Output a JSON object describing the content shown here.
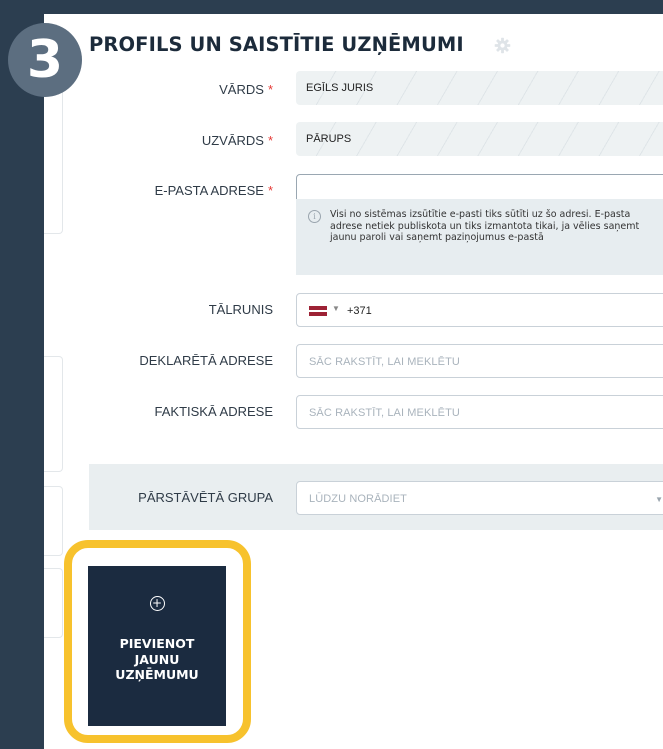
{
  "step_number": "3",
  "section": {
    "title": "PROFILS UN SAISTĪTIE UZŅĒMUMI",
    "settings_icon": "gear-icon"
  },
  "form": {
    "first_name": {
      "label": "VĀRDS",
      "required_mark": "*",
      "value": "EGĪLS JURIS"
    },
    "last_name": {
      "label": "UZVĀRDS",
      "required_mark": "*",
      "value": "PĀRUPS"
    },
    "email": {
      "label": "E-PASTA ADRESE",
      "required_mark": "*",
      "value": "",
      "hint": "Visi no sistēmas izsūtītie e-pasti tiks sūtīti uz šo adresi. E-pasta adrese netiek publiskota un tiks izmantota tikai, ja vēlies saņemt jaunu paroli vai saņemt paziņojumus e-pastā"
    },
    "phone": {
      "label": "TĀLRUNIS",
      "country_flag": "latvia-flag",
      "dial_code": "+371"
    },
    "declared_address": {
      "label": "DEKLARĒTĀ ADRESE",
      "placeholder": "SĀC RAKSTĪT, LAI MEKLĒTU"
    },
    "actual_address": {
      "label": "FAKTISKĀ ADRESE",
      "placeholder": "SĀC RAKSTĪT, LAI MEKLĒTU"
    },
    "represented_group": {
      "label": "PĀRSTĀVĒTĀ GRUPA",
      "selected": "LŪDZU NORĀDIET"
    }
  },
  "add_company_button": {
    "icon": "plus-circle-icon",
    "label": "PIEVIENOT\nJAUNU\nUZŅĒMUMU"
  },
  "colors": {
    "background_dark": "#2c3e50",
    "button_dark": "#1b2b40",
    "highlight": "#f7c22d",
    "required": "#e53935",
    "step_badge": "#5c6e80"
  }
}
